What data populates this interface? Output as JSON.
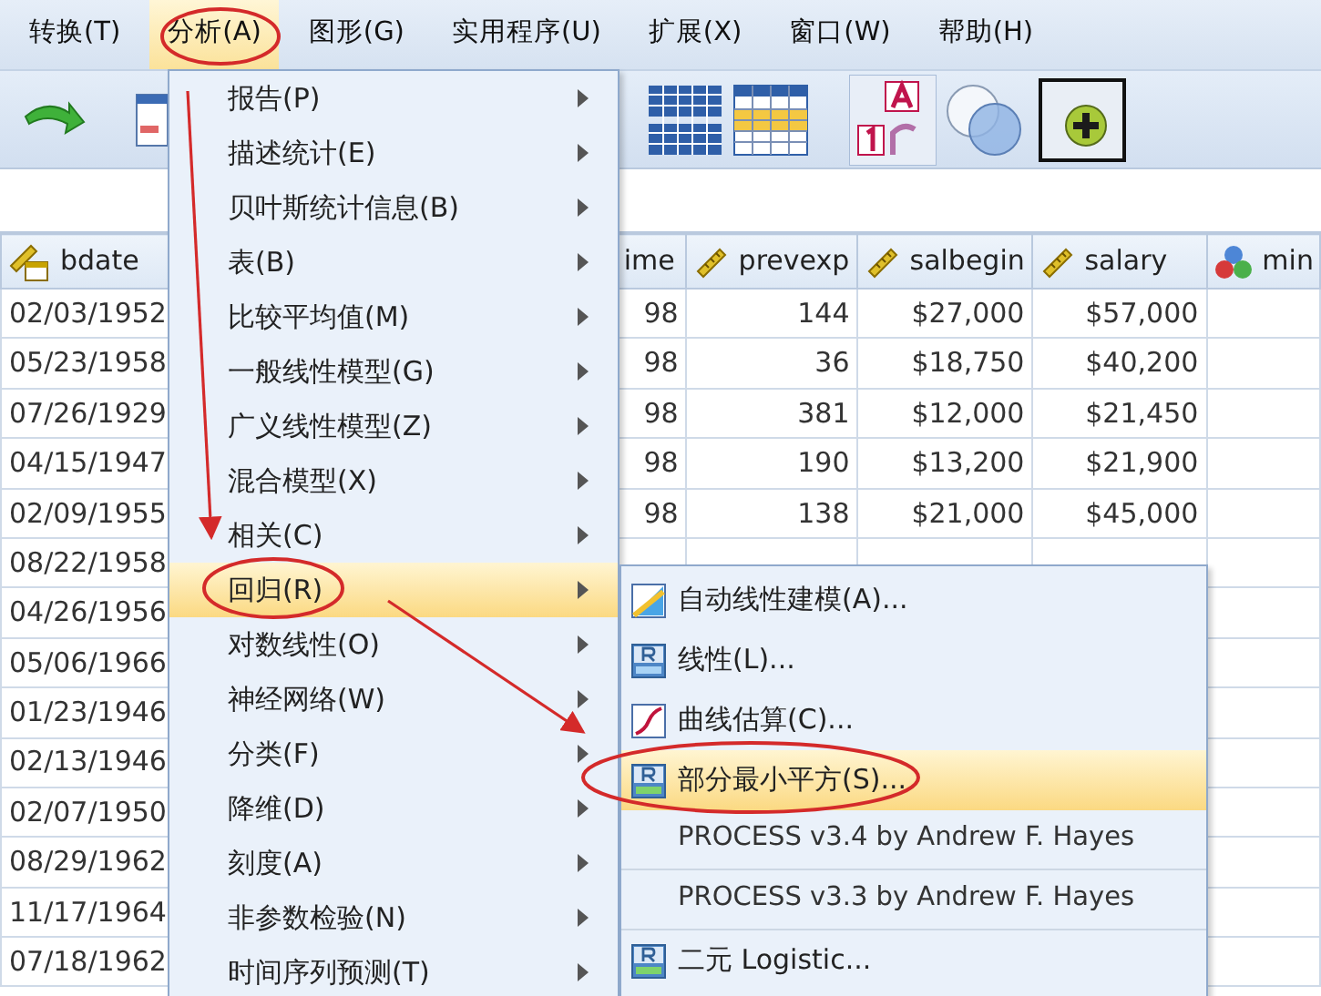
{
  "menubar": [
    {
      "label": "转换(T)",
      "selected": false
    },
    {
      "label": "分析(A)",
      "selected": true
    },
    {
      "label": "图形(G)",
      "selected": false
    },
    {
      "label": "实用程序(U)",
      "selected": false
    },
    {
      "label": "扩展(X)",
      "selected": false
    },
    {
      "label": "窗口(W)",
      "selected": false
    },
    {
      "label": "帮助(H)",
      "selected": false
    }
  ],
  "grid": {
    "columns": [
      {
        "label": "bdate",
        "kind": "date"
      },
      {
        "label": "ime",
        "kind": "cut"
      },
      {
        "label": "prevexp",
        "kind": "scale"
      },
      {
        "label": "salbegin",
        "kind": "scale"
      },
      {
        "label": "salary",
        "kind": "scale"
      },
      {
        "label": "min",
        "kind": "nominal"
      }
    ],
    "rows": [
      [
        "02/03/1952",
        "98",
        "144",
        "$27,000",
        "$57,000"
      ],
      [
        "05/23/1958",
        "98",
        "36",
        "$18,750",
        "$40,200"
      ],
      [
        "07/26/1929",
        "98",
        "381",
        "$12,000",
        "$21,450"
      ],
      [
        "04/15/1947",
        "98",
        "190",
        "$13,200",
        "$21,900"
      ],
      [
        "02/09/1955",
        "98",
        "138",
        "$21,000",
        "$45,000"
      ],
      [
        "08/22/1958"
      ],
      [
        "04/26/1956"
      ],
      [
        "05/06/1966"
      ],
      [
        "01/23/1946"
      ],
      [
        "02/13/1946"
      ],
      [
        "02/07/1950"
      ],
      [
        "08/29/1962"
      ],
      [
        "11/17/1964"
      ],
      [
        "07/18/1962"
      ]
    ]
  },
  "analyze_menu": {
    "items": [
      {
        "label": "报告(P)",
        "selected": false
      },
      {
        "label": "描述统计(E)",
        "selected": false
      },
      {
        "label": "贝叶斯统计信息(B)",
        "selected": false
      },
      {
        "label": "表(B)",
        "selected": false
      },
      {
        "label": "比较平均值(M)",
        "selected": false
      },
      {
        "label": "一般线性模型(G)",
        "selected": false
      },
      {
        "label": "广义线性模型(Z)",
        "selected": false
      },
      {
        "label": "混合模型(X)",
        "selected": false
      },
      {
        "label": "相关(C)",
        "selected": false
      },
      {
        "label": "回归(R)",
        "selected": true
      },
      {
        "label": "对数线性(O)",
        "selected": false
      },
      {
        "label": "神经网络(W)",
        "selected": false
      },
      {
        "label": "分类(F)",
        "selected": false
      },
      {
        "label": "降维(D)",
        "selected": false
      },
      {
        "label": "刻度(A)",
        "selected": false
      },
      {
        "label": "非参数检验(N)",
        "selected": false
      },
      {
        "label": "时间序列预测(T)",
        "selected": false
      }
    ]
  },
  "regression_submenu": {
    "items": [
      {
        "label": "自动线性建模(A)...",
        "kind": "automodel",
        "selected": false
      },
      {
        "label": "线性(L)...",
        "kind": "rlin",
        "selected": false
      },
      {
        "label": "曲线估算(C)...",
        "kind": "curve",
        "selected": false
      },
      {
        "label": "部分最小平方(S)...",
        "kind": "rpls",
        "selected": true
      },
      {
        "label": "PROCESS v3.4 by Andrew F. Hayes",
        "kind": "plain",
        "selected": false
      },
      {
        "label": "PROCESS v3.3 by Andrew F. Hayes",
        "kind": "plain",
        "selected": false
      },
      {
        "label": "二元 Logistic...",
        "kind": "rlog",
        "selected": false
      }
    ]
  }
}
